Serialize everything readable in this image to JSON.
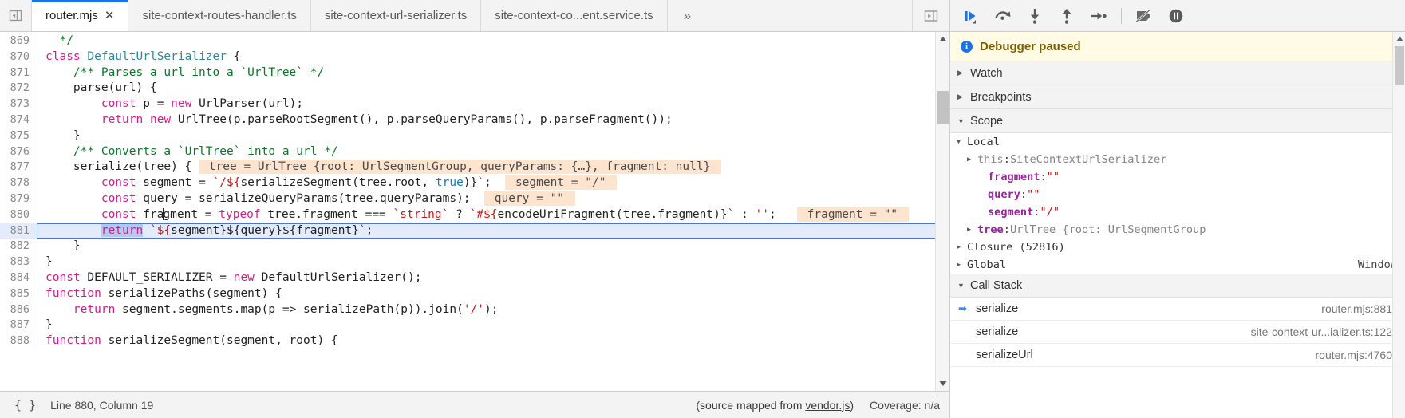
{
  "editor": {
    "nav_back_icon": "panel-collapse-left-icon",
    "tabs": [
      {
        "label": "router.mjs",
        "active": true,
        "closable": true
      },
      {
        "label": "site-context-routes-handler.ts",
        "active": false,
        "closable": false
      },
      {
        "label": "site-context-url-serializer.ts",
        "active": false,
        "closable": false
      },
      {
        "label": "site-context-co...ent.service.ts",
        "active": false,
        "closable": false
      }
    ],
    "more_tabs_label": "»",
    "show_navigator_icon": "show-navigator-icon",
    "lines": [
      {
        "num": "869",
        "tokens": [
          {
            "t": "  ",
            "c": "pl"
          },
          {
            "t": "*/",
            "c": "cm"
          }
        ]
      },
      {
        "num": "870",
        "tokens": [
          {
            "t": "class ",
            "c": "k"
          },
          {
            "t": "DefaultUrlSerializer",
            "c": "cls"
          },
          {
            "t": " {",
            "c": "pl"
          }
        ]
      },
      {
        "num": "871",
        "tokens": [
          {
            "t": "    ",
            "c": "pl"
          },
          {
            "t": "/** Parses a url into a `UrlTree` */",
            "c": "cm"
          }
        ]
      },
      {
        "num": "872",
        "tokens": [
          {
            "t": "    parse(url) {",
            "c": "pl"
          }
        ]
      },
      {
        "num": "873",
        "tokens": [
          {
            "t": "        ",
            "c": "pl"
          },
          {
            "t": "const",
            "c": "k"
          },
          {
            "t": " p = ",
            "c": "pl"
          },
          {
            "t": "new",
            "c": "k"
          },
          {
            "t": " UrlParser(url);",
            "c": "pl"
          }
        ]
      },
      {
        "num": "874",
        "tokens": [
          {
            "t": "        ",
            "c": "pl"
          },
          {
            "t": "return",
            "c": "k"
          },
          {
            "t": " ",
            "c": "pl"
          },
          {
            "t": "new",
            "c": "k"
          },
          {
            "t": " UrlTree(p.parseRootSegment(), p.parseQueryParams(), p.parseFragment());",
            "c": "pl"
          }
        ]
      },
      {
        "num": "875",
        "tokens": [
          {
            "t": "    }",
            "c": "pl"
          }
        ]
      },
      {
        "num": "876",
        "tokens": [
          {
            "t": "    ",
            "c": "pl"
          },
          {
            "t": "/** Converts a `UrlTree` into a url */",
            "c": "cm"
          }
        ]
      },
      {
        "num": "877",
        "tokens": [
          {
            "t": "    serialize(tree) { ",
            "c": "pl"
          },
          {
            "t": " tree = UrlTree {root: UrlSegmentGroup, queryParams: {…}, fragment: null} ",
            "c": "iv"
          }
        ]
      },
      {
        "num": "878",
        "tokens": [
          {
            "t": "        ",
            "c": "pl"
          },
          {
            "t": "const",
            "c": "k"
          },
          {
            "t": " segment = ",
            "c": "pl"
          },
          {
            "t": "`/${",
            "c": "str"
          },
          {
            "t": "serializeSegment(tree.root, ",
            "c": "pl"
          },
          {
            "t": "true",
            "c": "kb"
          },
          {
            "t": ")}",
            "c": "pl"
          },
          {
            "t": "`",
            "c": "str"
          },
          {
            "t": ";  ",
            "c": "pl"
          },
          {
            "t": " segment = \"/\" ",
            "c": "iv"
          }
        ]
      },
      {
        "num": "879",
        "tokens": [
          {
            "t": "        ",
            "c": "pl"
          },
          {
            "t": "const",
            "c": "k"
          },
          {
            "t": " query = serializeQueryParams(tree.queryParams);  ",
            "c": "pl"
          },
          {
            "t": " query = \"\" ",
            "c": "iv"
          }
        ]
      },
      {
        "num": "880",
        "tokens": [
          {
            "t": "        ",
            "c": "pl"
          },
          {
            "t": "const",
            "c": "k"
          },
          {
            "t": " fra",
            "c": "pl"
          },
          {
            "t": "|",
            "c": "caret"
          },
          {
            "t": "gment = ",
            "c": "pl"
          },
          {
            "t": "typeof",
            "c": "k"
          },
          {
            "t": " tree.fragment === ",
            "c": "pl"
          },
          {
            "t": "`string`",
            "c": "str"
          },
          {
            "t": " ? ",
            "c": "pl"
          },
          {
            "t": "`#${",
            "c": "str"
          },
          {
            "t": "encodeUriFragment(tree.fragment)}",
            "c": "pl"
          },
          {
            "t": "`",
            "c": "str"
          },
          {
            "t": " : ",
            "c": "pl"
          },
          {
            "t": "''",
            "c": "str"
          },
          {
            "t": ";   ",
            "c": "pl"
          },
          {
            "t": " fragment = \"\" ",
            "c": "iv"
          }
        ]
      },
      {
        "num": "881",
        "exec": true,
        "tokens": [
          {
            "t": "        ",
            "c": "pl"
          },
          {
            "t": "return",
            "c": "k sel"
          },
          {
            "t": " ",
            "c": "pl"
          },
          {
            "t": "`${",
            "c": "str"
          },
          {
            "t": "segment}${",
            "c": "pl"
          },
          {
            "t": "query}${",
            "c": "pl"
          },
          {
            "t": "fragment}",
            "c": "pl"
          },
          {
            "t": "`",
            "c": "str"
          },
          {
            "t": ";",
            "c": "pl"
          }
        ]
      },
      {
        "num": "882",
        "tokens": [
          {
            "t": "    }",
            "c": "pl"
          }
        ]
      },
      {
        "num": "883",
        "tokens": [
          {
            "t": "}",
            "c": "pl"
          }
        ]
      },
      {
        "num": "884",
        "tokens": [
          {
            "t": "const",
            "c": "k"
          },
          {
            "t": " DEFAULT_SERIALIZER = ",
            "c": "pl"
          },
          {
            "t": "new",
            "c": "k"
          },
          {
            "t": " DefaultUrlSerializer();",
            "c": "pl"
          }
        ]
      },
      {
        "num": "885",
        "tokens": [
          {
            "t": "function",
            "c": "k"
          },
          {
            "t": " serializePaths(segment) {",
            "c": "pl"
          }
        ]
      },
      {
        "num": "886",
        "tokens": [
          {
            "t": "    ",
            "c": "pl"
          },
          {
            "t": "return",
            "c": "k"
          },
          {
            "t": " segment.segments.map(p => serializePath(p)).join(",
            "c": "pl"
          },
          {
            "t": "'/'",
            "c": "str"
          },
          {
            "t": ");",
            "c": "pl"
          }
        ]
      },
      {
        "num": "887",
        "tokens": [
          {
            "t": "}",
            "c": "pl"
          }
        ]
      },
      {
        "num": "888",
        "tokens": [
          {
            "t": "function",
            "c": "k"
          },
          {
            "t": " serializeSegment(segment, root) {",
            "c": "pl"
          }
        ]
      }
    ]
  },
  "statusbar": {
    "format_icon": "pretty-print-braces-icon",
    "position": "Line 880, Column 19",
    "source_map_prefix": "(source mapped from ",
    "source_map_link": "vendor.js",
    "source_map_suffix": ")",
    "coverage": "Coverage: n/a"
  },
  "debugger": {
    "toolbar": [
      {
        "name": "resume-script-execution-button",
        "icon": "resume-icon",
        "title": "Resume script execution",
        "accent": "#1a73e8"
      },
      {
        "name": "step-over-button",
        "icon": "step-over-icon",
        "title": "Step over next function call",
        "accent": "#5a5a5a"
      },
      {
        "name": "step-into-button",
        "icon": "step-into-icon",
        "title": "Step into next function call",
        "accent": "#5a5a5a"
      },
      {
        "name": "step-out-button",
        "icon": "step-out-icon",
        "title": "Step out of current function",
        "accent": "#5a5a5a"
      },
      {
        "name": "step-button",
        "icon": "step-icon",
        "title": "Step",
        "accent": "#5a5a5a"
      },
      {
        "name": "deactivate-breakpoints-button",
        "icon": "deactivate-breakpoints-icon",
        "title": "Deactivate breakpoints",
        "accent": "#5a5a5a"
      },
      {
        "name": "pause-on-exceptions-button",
        "icon": "pause-on-exceptions-icon",
        "title": "Pause on exceptions",
        "accent": "#5a5a5a"
      }
    ],
    "paused_banner": {
      "icon": "info-icon",
      "icon_glyph": "i",
      "text": "Debugger paused"
    },
    "sections": [
      {
        "name": "watch",
        "label": "Watch",
        "expanded": false
      },
      {
        "name": "breakpoints",
        "label": "Breakpoints",
        "expanded": false
      },
      {
        "name": "scope",
        "label": "Scope",
        "expanded": true
      },
      {
        "name": "call-stack",
        "label": "Call Stack",
        "expanded": true
      }
    ],
    "scope": [
      {
        "indent": 1,
        "tri": "d",
        "name": "Local",
        "name_class": "nm-plain",
        "sep": "",
        "value": "",
        "value_class": ""
      },
      {
        "indent": 2,
        "tri": "r",
        "name": "this",
        "name_class": "nm-this",
        "sep": ": ",
        "value": "SiteContextUrlSerializer",
        "value_class": "val-obj"
      },
      {
        "indent": 3,
        "tri": "",
        "name": "fragment",
        "name_class": "nm-prop",
        "sep": ": ",
        "value": "\"\"",
        "value_class": "val-str"
      },
      {
        "indent": 3,
        "tri": "",
        "name": "query",
        "name_class": "nm-prop",
        "sep": ": ",
        "value": "\"\"",
        "value_class": "val-str"
      },
      {
        "indent": 3,
        "tri": "",
        "name": "segment",
        "name_class": "nm-prop",
        "sep": ": ",
        "value": "\"/\"",
        "value_class": "val-str"
      },
      {
        "indent": 2,
        "tri": "r",
        "name": "tree",
        "name_class": "nm-prop",
        "sep": ": ",
        "value": "UrlTree {root: UrlSegmentGroup",
        "value_class": "val-obj"
      },
      {
        "indent": 1,
        "tri": "r",
        "name": "Closure (52816)",
        "name_class": "nm-plain",
        "sep": "",
        "value": "",
        "value_class": ""
      },
      {
        "indent": 1,
        "tri": "r",
        "name": "Global",
        "name_class": "nm-plain",
        "sep": "",
        "value": "",
        "value_class": "",
        "right": "Window"
      }
    ],
    "call_stack": [
      {
        "current": true,
        "marker": "➡",
        "fn": "serialize",
        "location": "router.mjs:881"
      },
      {
        "current": false,
        "marker": "",
        "fn": "serialize",
        "location": "site-context-ur...ializer.ts:122"
      },
      {
        "current": false,
        "marker": "",
        "fn": "serializeUrl",
        "location": "router.mjs:4760"
      }
    ]
  }
}
